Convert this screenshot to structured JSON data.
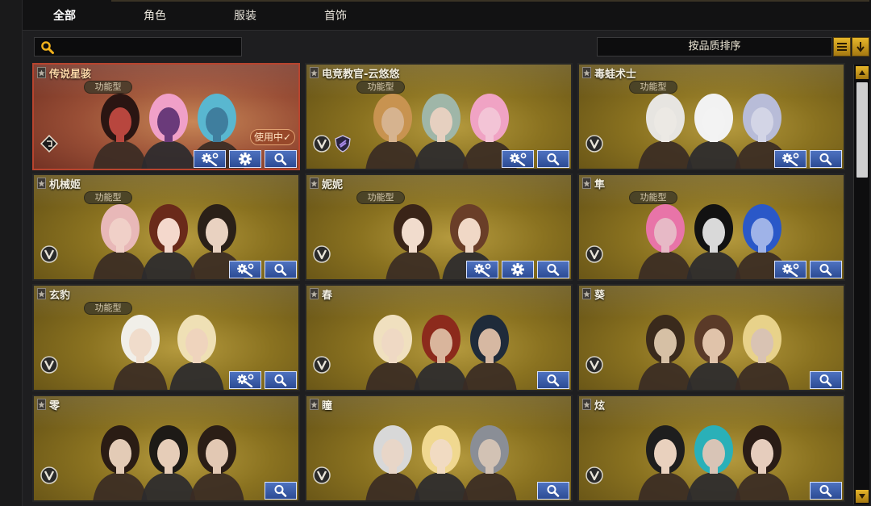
{
  "tabs": [
    {
      "label": "全部",
      "active": true
    },
    {
      "label": "角色",
      "active": false
    },
    {
      "label": "服装",
      "active": false
    },
    {
      "label": "首饰",
      "active": false
    }
  ],
  "search": {
    "value": "",
    "placeholder": ""
  },
  "sort": {
    "label": "按品质排序"
  },
  "tag_label": "功能型",
  "in_use_label": "使用中✓",
  "colors": {
    "accent_gold": "#c9a031",
    "button_blue": "#3a5dab",
    "selected_red": "#b8442e"
  },
  "cards": [
    {
      "name": "传说星骇",
      "tag": true,
      "selected": true,
      "tool": true,
      "gear": true,
      "badge": "rune",
      "skin": [
        "#b8463e",
        "#6a3a7a",
        "#3f7e9e"
      ],
      "hair": [
        "#2a1512",
        "#f0a0c8",
        "#59b7d0"
      ]
    },
    {
      "name": "电竞教官-云悠悠",
      "tag": true,
      "selected": false,
      "tool": true,
      "gear": false,
      "badge": "v+shield",
      "skin": [
        "#d6b38f",
        "#e6d0c0",
        "#f3c4d6"
      ],
      "hair": [
        "#c89350",
        "#9fb6a8",
        "#f0a3c4"
      ]
    },
    {
      "name": "毒蛙术士",
      "tag": true,
      "selected": false,
      "tool": true,
      "gear": false,
      "badge": "v",
      "skin": [
        "#ece9e4",
        "#f3f3f3",
        "#d3d5e6"
      ],
      "hair": [
        "#e7e5e1",
        "#f2f2f2",
        "#b8bcd8"
      ]
    },
    {
      "name": "机械姬",
      "tag": true,
      "selected": false,
      "tool": true,
      "gear": false,
      "badge": "v",
      "skin": [
        "#f0d0c8",
        "#f4d8cc",
        "#e9d2c1"
      ],
      "hair": [
        "#e8b8b8",
        "#6a2a1a",
        "#2a2018"
      ]
    },
    {
      "name": "妮妮",
      "tag": true,
      "selected": false,
      "tool": true,
      "gear": true,
      "badge": "v",
      "skin": [
        "#f1dccd",
        "#f0d8c6"
      ],
      "hair": [
        "#3a2418",
        "#6a3e28"
      ]
    },
    {
      "name": "隼",
      "tag": true,
      "selected": false,
      "tool": true,
      "gear": false,
      "badge": "v",
      "skin": [
        "#e7b9c6",
        "#d9d9d9",
        "#9fb3e8"
      ],
      "hair": [
        "#e874a8",
        "#121212",
        "#2a58c8"
      ]
    },
    {
      "name": "玄豹",
      "tag": true,
      "selected": false,
      "tool": true,
      "gear": false,
      "badge": "v",
      "skin": [
        "#f0dccb",
        "#efd4bd"
      ],
      "hair": [
        "#f1efe9",
        "#efe0b5"
      ]
    },
    {
      "name": "春",
      "tag": false,
      "selected": false,
      "tool": false,
      "gear": false,
      "badge": "v",
      "skin": [
        "#efd9c4",
        "#d9b59c",
        "#d6b8a2"
      ],
      "hair": [
        "#f0e0bf",
        "#8c2a1c",
        "#1f2b3a"
      ]
    },
    {
      "name": "葵",
      "tag": false,
      "selected": false,
      "tool": false,
      "gear": false,
      "badge": "v",
      "skin": [
        "#d6c0a5",
        "#e0c3aa",
        "#d9c3b3"
      ],
      "hair": [
        "#3a2a1c",
        "#5a3a28",
        "#e8d28a"
      ]
    },
    {
      "name": "零",
      "tag": false,
      "selected": false,
      "tool": false,
      "gear": false,
      "badge": "v",
      "skin": [
        "#e3cbb6",
        "#e6cdb8",
        "#e2c8b3"
      ],
      "hair": [
        "#2a1c14",
        "#1d1a16",
        "#2b1e16"
      ]
    },
    {
      "name": "瞳",
      "tag": false,
      "selected": false,
      "tool": false,
      "gear": false,
      "badge": "v",
      "skin": [
        "#e8d6c8",
        "#f1dbc2",
        "#d2c2b4"
      ],
      "hair": [
        "#d8d8d8",
        "#f0d890",
        "#8a8e96"
      ]
    },
    {
      "name": "炫",
      "tag": false,
      "selected": false,
      "tool": false,
      "gear": false,
      "badge": "v",
      "skin": [
        "#e9d1be",
        "#d8c4b6",
        "#e6cdbd"
      ],
      "hair": [
        "#1e1e1e",
        "#2ab0b8",
        "#2a1c16"
      ]
    }
  ]
}
